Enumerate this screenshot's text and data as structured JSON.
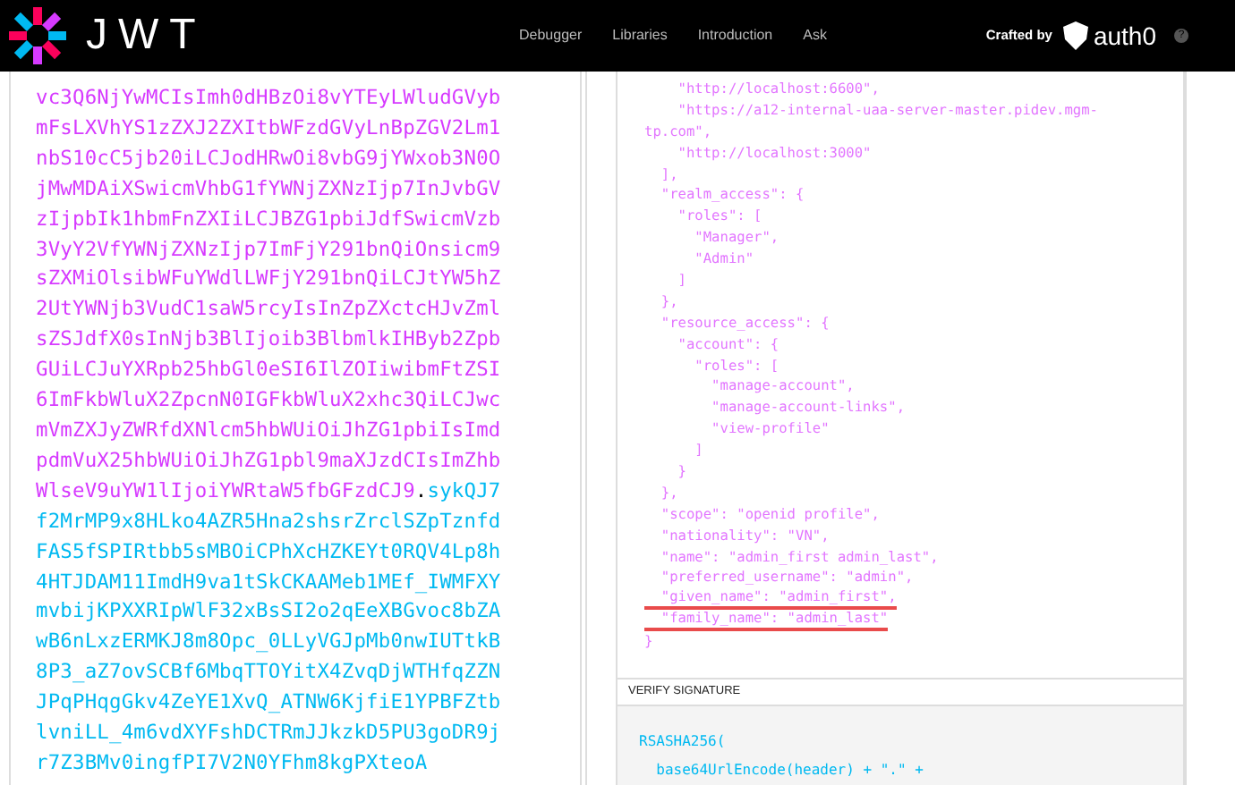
{
  "header": {
    "logo_text": "JWT",
    "nav": [
      {
        "label": "Debugger"
      },
      {
        "label": "Libraries"
      },
      {
        "label": "Introduction"
      },
      {
        "label": "Ask"
      }
    ],
    "crafted_by": "Crafted by",
    "brand": "auth0",
    "help": "?"
  },
  "encoded": {
    "payload": "vc3Q6NjYwMCIsImh0dHBzOi8vYTEyLWludGVybmFsLXVhYS1zZXJ2ZXItbWFzdGVyLnBpZGV2Lm1nbS10cC5jb20iLCJodHRwOi8vbG9jYWxob3N0OjMwMDAiXSwicmVhbG1fYWNjZXNzIjp7InJvbGVzIjpbIk1hbmFnZXIiLCJBZG1pbiJdfSwicmVzb3VyY2VfYWNjZXNzIjp7ImFjY291bnQiOnsicm9sZXMiOlsibWFuYWdlLWFjY291bnQiLCJtYW5hZ2UtYWNjb3VudC1saW5rcyIsInZpZXctcHJvZmlsZSJdfX0sInNjb3BlIjoib3BlbmlkIHByb2ZpbGUiLCJuYXRpb25hbGl0eSI6IlZOIiwibmFtZSI6ImFkbWluX2ZpcnN0IGFkbWluX2xhc3QiLCJwcmVmZXJyZWRfdXNlcm5hbWUiOiJhZG1pbiIsImdpdmVuX25hbWUiOiJhZG1pbl9maXJzdCIsImZhbWlseV9uYW1lIjoiYWRtaW5fbGFzdCJ9",
    "separator": ".",
    "signature": "sykQJ7f2MrMP9x8HLko4AZR5Hna2shsrZrclSZpTznfdFAS5fSPIRtbb5sMBOiCPhXcHZKEYt0RQV4Lp8h4HTJDAM11ImdH9va1tSkCKAAMeb1MEf_IWMFXYmvbijKPXXRIpWlF32xBsSI2o2qEeXBGvoc8bZAwB6nLxzERMKJ8m8Opc_0LLyVGJpMb0nwIUTtkB8P3_aZ7ovSCBf6MbqTTOYitX4ZvqDjWTHfqZZNJPqPHqgGkv4ZeYE1XvQ_ATNW6KjfiE1YPBFZtblvniLL_4m6vdXYFshDCTRmJJkzkD5PU3goDR9jr7Z3BMv0ingfPI7V2N0YFhm8kgPXteoA"
  },
  "payload_lines": [
    {
      "text": "    \"http://localhost:6600\",",
      "underlined": false
    },
    {
      "text": "    \"https://a12-internal-uaa-server-master.pidev.mgm-",
      "underlined": false
    },
    {
      "text": "tp.com\",",
      "underlined": false
    },
    {
      "text": "    \"http://localhost:3000\"",
      "underlined": false
    },
    {
      "text": "  ],",
      "underlined": false
    },
    {
      "text": "  \"realm_access\": {",
      "underlined": false
    },
    {
      "text": "    \"roles\": [",
      "underlined": false
    },
    {
      "text": "      \"Manager\",",
      "underlined": false
    },
    {
      "text": "      \"Admin\"",
      "underlined": false
    },
    {
      "text": "    ]",
      "underlined": false
    },
    {
      "text": "  },",
      "underlined": false
    },
    {
      "text": "  \"resource_access\": {",
      "underlined": false
    },
    {
      "text": "    \"account\": {",
      "underlined": false
    },
    {
      "text": "      \"roles\": [",
      "underlined": false
    },
    {
      "text": "        \"manage-account\",",
      "underlined": false
    },
    {
      "text": "        \"manage-account-links\",",
      "underlined": false
    },
    {
      "text": "        \"view-profile\"",
      "underlined": false
    },
    {
      "text": "      ]",
      "underlined": false
    },
    {
      "text": "    }",
      "underlined": false
    },
    {
      "text": "  },",
      "underlined": false
    },
    {
      "text": "  \"scope\": \"openid profile\",",
      "underlined": false
    },
    {
      "text": "  \"nationality\": \"VN\",",
      "underlined": false
    },
    {
      "text": "  \"name\": \"admin_first admin_last\",",
      "underlined": false
    },
    {
      "text": "  \"preferred_username\": \"admin\",",
      "underlined": false
    },
    {
      "text": "  \"given_name\": \"admin_first\",",
      "underlined": true
    },
    {
      "text": "  \"family_name\": \"admin_last\"",
      "underlined": true
    },
    {
      "text": "}",
      "underlined": false
    }
  ],
  "verify": {
    "title": "VERIFY SIGNATURE",
    "lines": [
      "RSASHA256(",
      "  base64UrlEncode(header) + \".\" +"
    ]
  }
}
